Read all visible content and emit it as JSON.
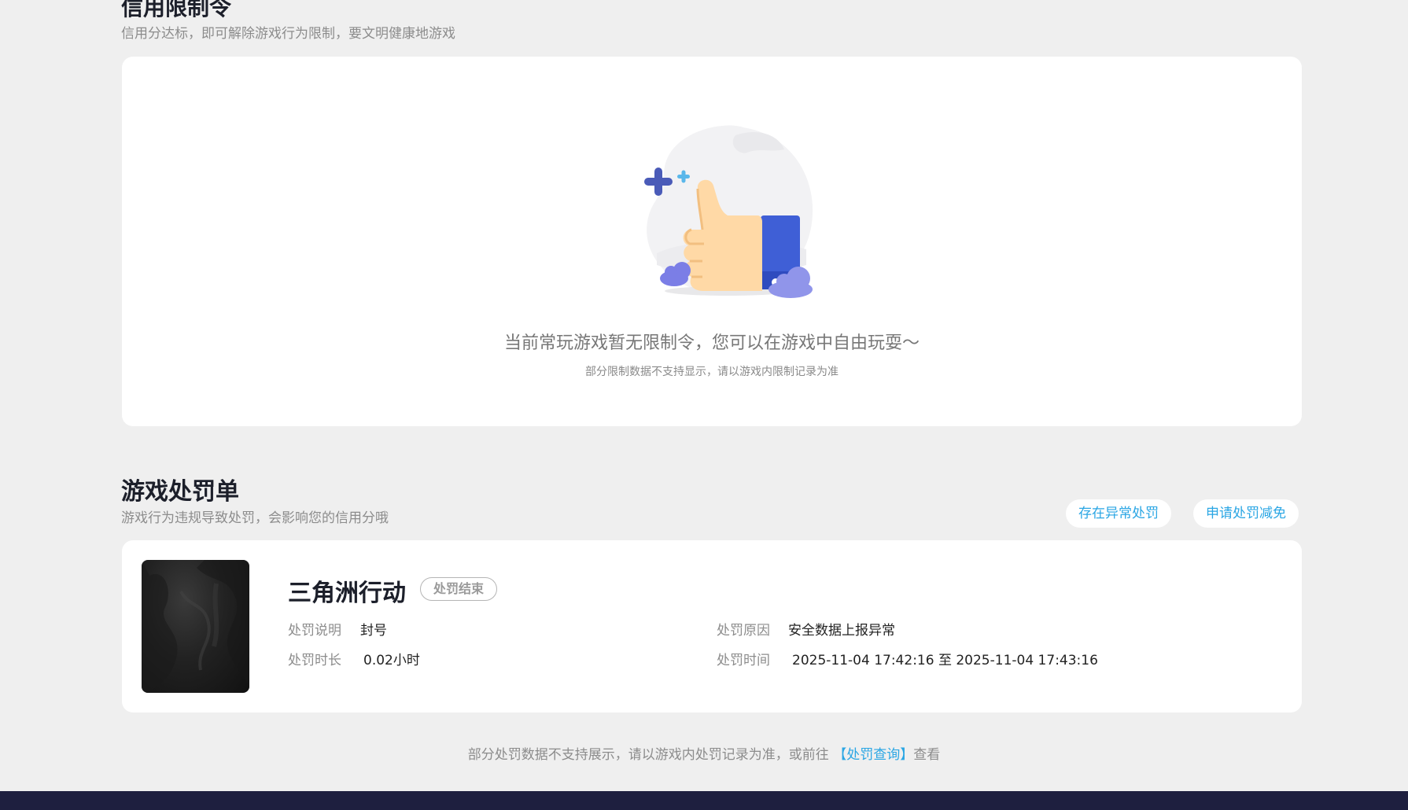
{
  "credit_limit": {
    "title": "信用限制令",
    "subtitle": "信用分达标，即可解除游戏行为限制，要文明健康地游戏",
    "empty_state": {
      "illustration_icon": "thumbs-up-icon",
      "message": "当前常玩游戏暂无限制令，您可以在游戏中自由玩耍～",
      "note": "部分限制数据不支持显示，请以游戏内限制记录为准"
    }
  },
  "penalties": {
    "title": "游戏处罚单",
    "subtitle": "游戏行为违规导致处罚，会影响您的信用分哦",
    "buttons": {
      "abnormal": "存在异常处罚",
      "appeal": "申请处罚减免"
    },
    "items": [
      {
        "game_name": "三角洲行动",
        "status": "处罚结束",
        "description_label": "处罚说明",
        "description_value": "封号",
        "duration_label": "处罚时长",
        "duration_value": "0.02小时",
        "reason_label": "处罚原因",
        "reason_value": "安全数据上报异常",
        "time_label": "处罚时间",
        "time_value": "2025-11-04 17:42:16 至 2025-11-04 17:43:16"
      }
    ],
    "footer": {
      "prefix": "部分处罚数据不支持展示，请以游戏内处罚记录为准，或前往 ",
      "link": "【处罚查询】",
      "suffix": "查看"
    }
  },
  "colors": {
    "accent": "#2aa6e4",
    "background": "#efefef",
    "bottom_bar": "#1e1f3f"
  }
}
